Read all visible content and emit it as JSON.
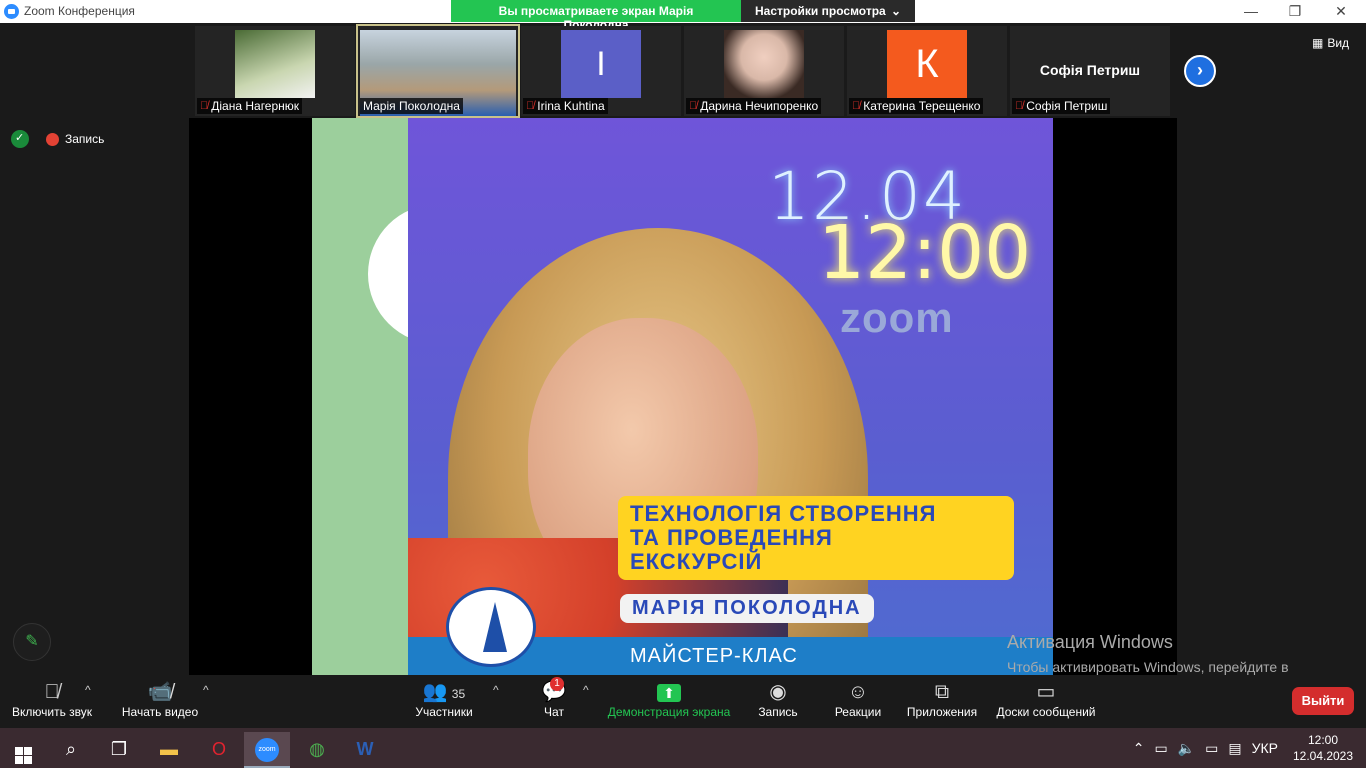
{
  "window": {
    "title": "Zoom Конференция",
    "minimize": "—",
    "restore": "❐",
    "close": "✕"
  },
  "share_banner": {
    "viewing_text": "Вы просматриваете экран Марія Поколодна",
    "view_settings": "Настройки просмотра",
    "chevron": "⌄"
  },
  "participants": [
    {
      "name": "Діана Нагернюк",
      "muted": true,
      "avatar_color": "#6a8a4a"
    },
    {
      "name": "Марія Поколодна",
      "muted": false,
      "avatar_color": "#b9a27a"
    },
    {
      "name": "Irina Kuhtina",
      "muted": true,
      "initial": "I",
      "avatar_color": "#5b5fc7"
    },
    {
      "name": "Дарина Нечипоренко",
      "muted": true,
      "avatar_color": "#d9b8a8"
    },
    {
      "name": "Катерина Терещенко",
      "muted": true,
      "initial": "К",
      "avatar_color": "#f45a1e"
    },
    {
      "name": "Софія Петриш",
      "muted": true,
      "display_name": "Софія Петриш"
    }
  ],
  "view_button": "Вид",
  "recording_label": "Запись",
  "poster": {
    "date": "12.04",
    "time": "12:00",
    "platform": "zoom",
    "title_lines": [
      "ТЕХНОЛОГІЯ СТВОРЕННЯ",
      "ТА ПРОВЕДЕННЯ",
      "ЕКСКУРСІЙ"
    ],
    "speaker": "МАРІЯ ПОКОЛОДНА",
    "event_type": "МАЙСТЕР-КЛАС"
  },
  "activation": {
    "title": "Активация Windows",
    "subtitle": "Чтобы активировать Windows, перейдите в раздел \"Параметры\"."
  },
  "toolbar": {
    "audio": "Включить звук",
    "video": "Начать видео",
    "participants": "Участники",
    "participants_count": "35",
    "chat": "Чат",
    "chat_badge": "1",
    "share": "Демонстрация экрана",
    "record": "Запись",
    "reactions": "Реакции",
    "apps": "Приложения",
    "whiteboards": "Доски сообщений",
    "leave": "Выйти"
  },
  "taskbar": {
    "language": "УКР",
    "time": "12:00",
    "date": "12.04.2023",
    "zoom_label": "zoom"
  }
}
